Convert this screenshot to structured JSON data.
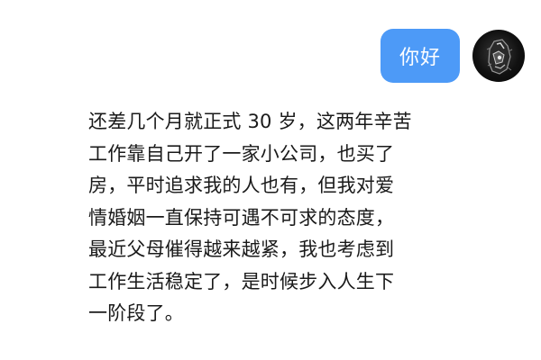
{
  "conversation": {
    "outgoing": {
      "text": "你好"
    },
    "incoming": {
      "lines": [
        "还差几个月就正式 30 岁，这两年辛苦",
        "工作靠自己开了一家小公司，也买了",
        "房，平时追求我的人也有，但我对爱",
        "情婚姻一直保持可遇不可求的态度，",
        "最近父母催得越来越紧，我也考虑到",
        "工作生活稳定了，是时候步入人生下",
        "一阶段了。"
      ]
    },
    "colors": {
      "outgoing_bubble": "#4d9af7",
      "incoming_text": "#1a1a1a",
      "background": "#ffffff"
    },
    "icons": {
      "avatar": "avatar-image"
    }
  }
}
